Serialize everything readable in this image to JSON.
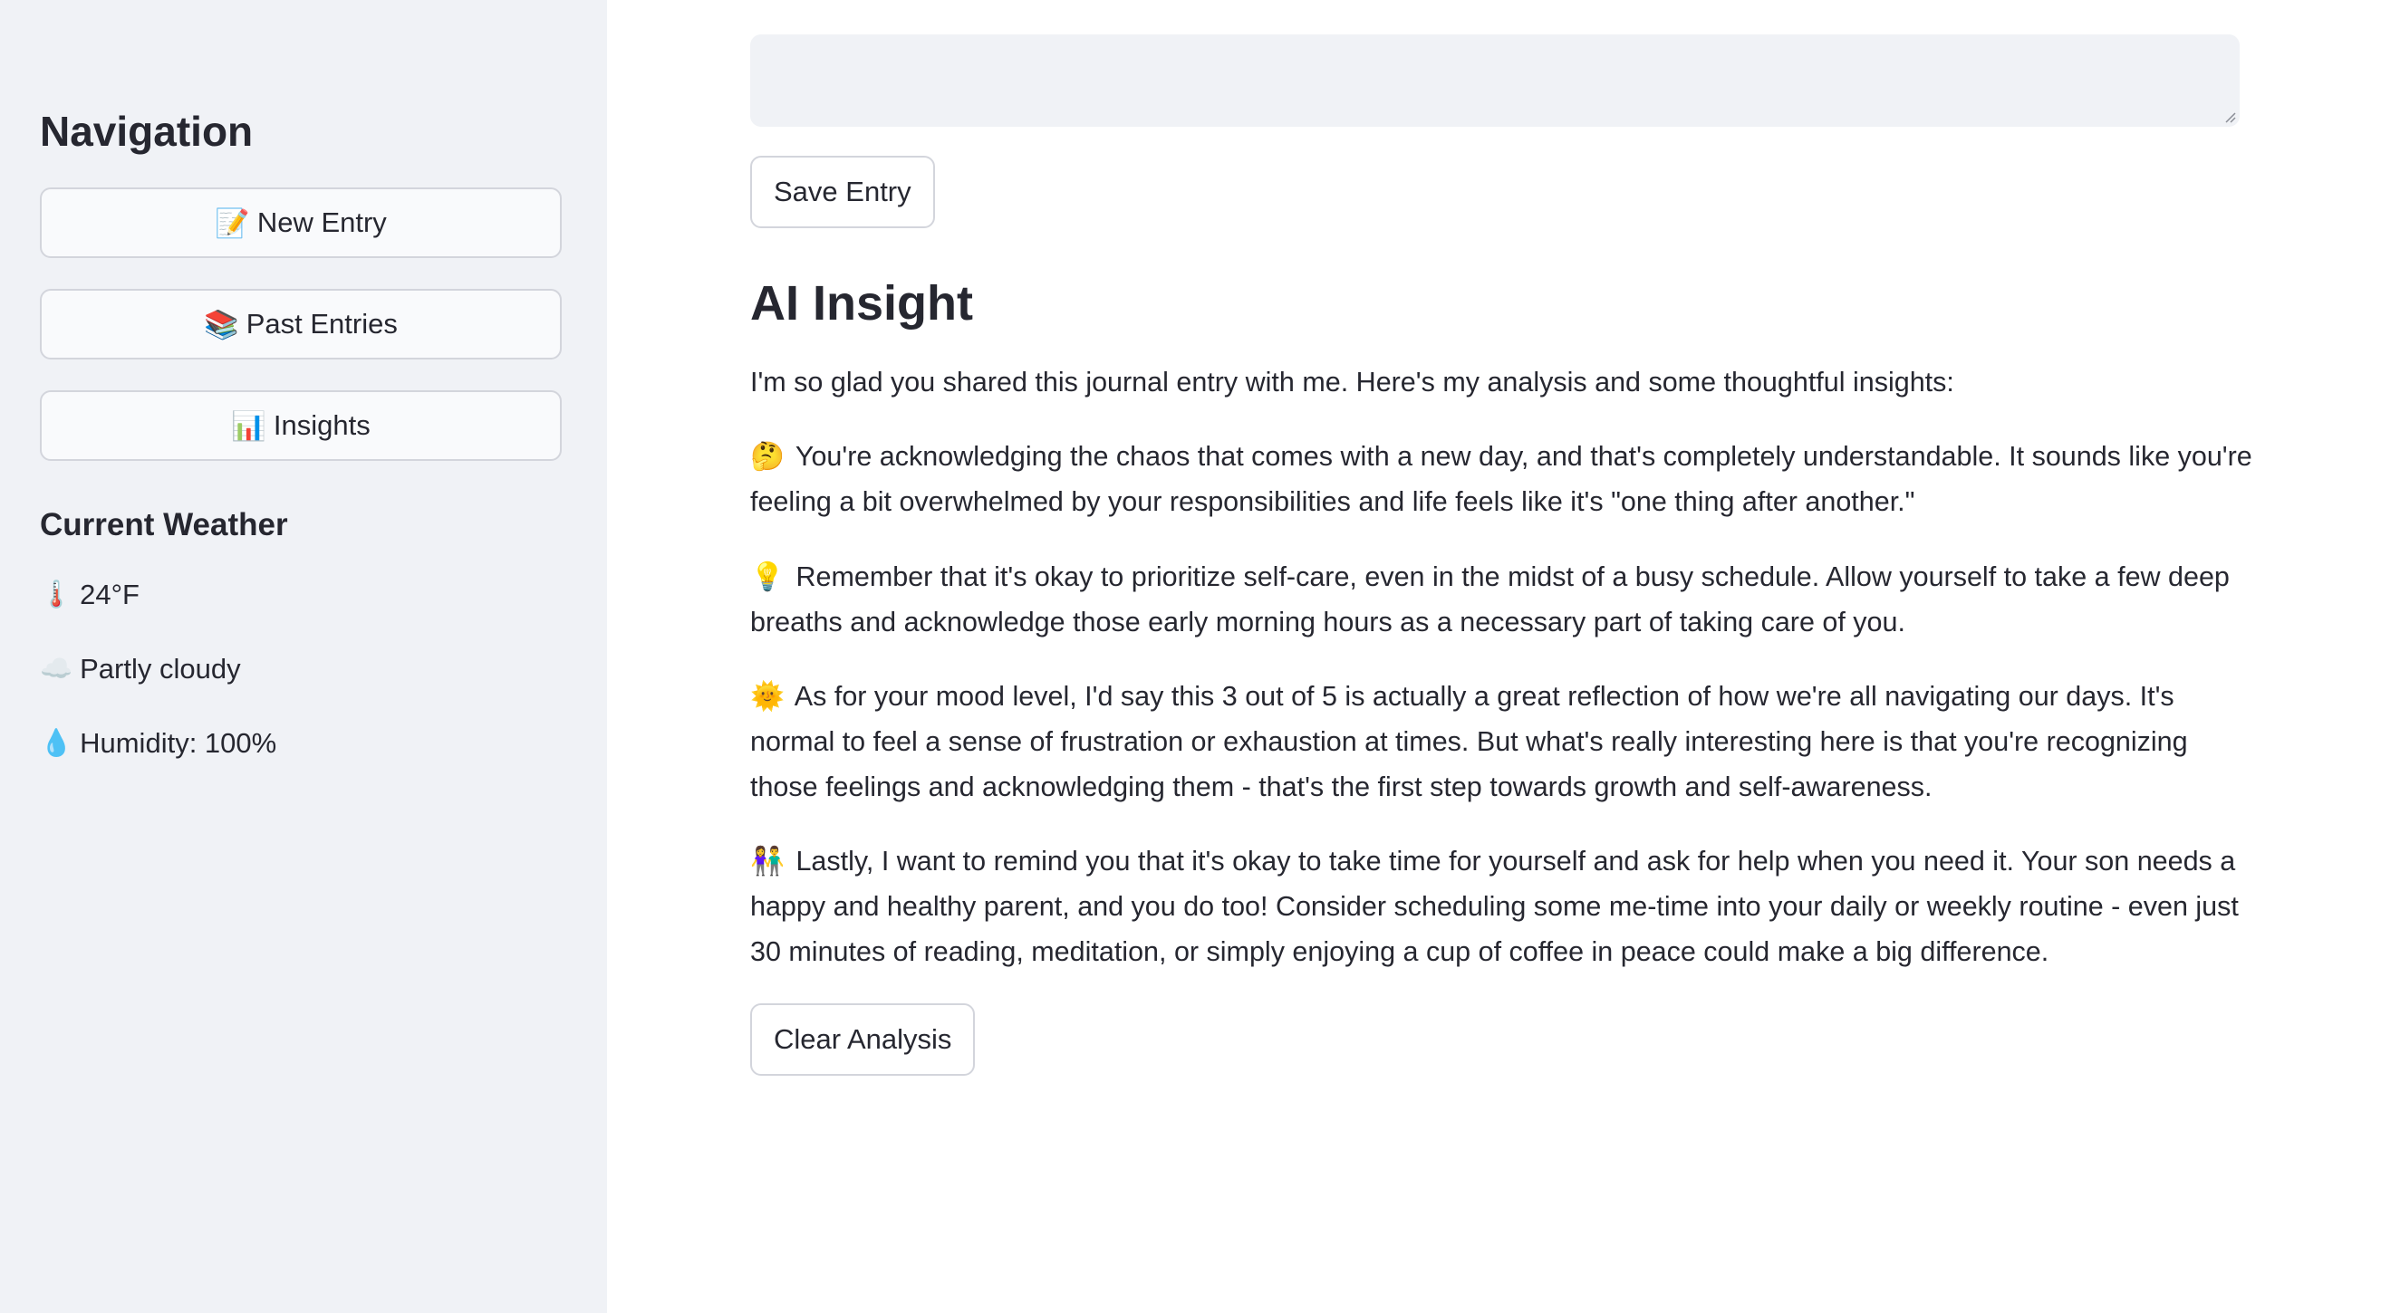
{
  "sidebar": {
    "title": "Navigation",
    "buttons": [
      {
        "icon": "📝",
        "label": "New Entry"
      },
      {
        "icon": "📚",
        "label": "Past Entries"
      },
      {
        "icon": "📊",
        "label": "Insights"
      }
    ],
    "weather": {
      "title": "Current Weather",
      "temperature": {
        "icon": "🌡️",
        "text": "24°F"
      },
      "condition": {
        "icon": "☁️",
        "text": "Partly cloudy"
      },
      "humidity": {
        "icon": "💧",
        "text": "Humidity: 100%"
      }
    }
  },
  "main": {
    "entry": {
      "value": "",
      "placeholder": ""
    },
    "save_label": "Save Entry",
    "insight_title": "AI Insight",
    "paragraphs": [
      {
        "icon": "",
        "text": "I'm so glad you shared this journal entry with me. Here's my analysis and some thoughtful insights:"
      },
      {
        "icon": "🤔",
        "text": "You're acknowledging the chaos that comes with a new day, and that's completely understandable. It sounds like you're feeling a bit overwhelmed by your responsibilities and life feels like it's \"one thing after another.\""
      },
      {
        "icon": "💡",
        "text": "Remember that it's okay to prioritize self-care, even in the midst of a busy schedule. Allow yourself to take a few deep breaths and acknowledge those early morning hours as a necessary part of taking care of you."
      },
      {
        "icon": "🌞",
        "text": "As for your mood level, I'd say this 3 out of 5 is actually a great reflection of how we're all navigating our days. It's normal to feel a sense of frustration or exhaustion at times. But what's really interesting here is that you're recognizing those feelings and acknowledging them - that's the first step towards growth and self-awareness."
      },
      {
        "icon": "👫",
        "text": "Lastly, I want to remind you that it's okay to take time for yourself and ask for help when you need it. Your son needs a happy and healthy parent, and you do too! Consider scheduling some me-time into your daily or weekly routine - even just 30 minutes of reading, meditation, or simply enjoying a cup of coffee in peace could make a big difference."
      }
    ],
    "clear_label": "Clear Analysis"
  }
}
